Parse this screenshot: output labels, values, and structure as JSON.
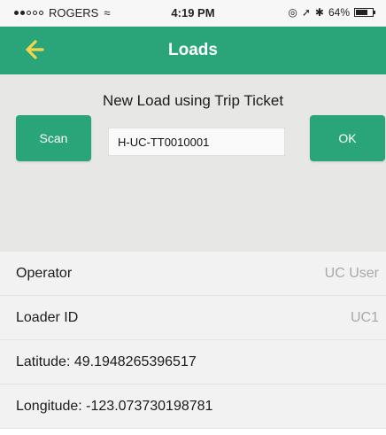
{
  "status_bar": {
    "carrier": "ROGERS",
    "time": "4:19 PM",
    "battery": "64%",
    "icons": [
      "signal-icon",
      "wifi-icon",
      "location-icon",
      "bluetooth-icon",
      "battery-icon"
    ]
  },
  "nav": {
    "title": "Loads",
    "back_icon": "back-arrow-icon",
    "accent_color": "#2aa57a",
    "back_icon_color": "#f3d64a"
  },
  "scan_panel": {
    "heading": "New Load using Trip Ticket",
    "scan_label": "Scan",
    "ticket_value": "H-UC-TT0010001",
    "ok_label": "OK"
  },
  "info": {
    "operator_label": "Operator",
    "operator_value": "UC User",
    "loader_label": "Loader ID",
    "loader_value": "UC1",
    "latitude": "Latitude: 49.1948265396517",
    "longitude": "Longitude: -123.073730198781"
  }
}
